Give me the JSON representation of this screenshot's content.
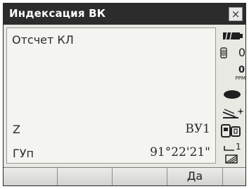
{
  "window": {
    "title": "Индексация ВК",
    "close_label": "×"
  },
  "main": {
    "header": "Отсчет КЛ",
    "rows": [
      {
        "label": "Z",
        "value": "ВУ1"
      },
      {
        "label": "ГУп",
        "value": "91°22'21\""
      }
    ]
  },
  "status": {
    "battery_icon": "battery-icon",
    "prism_constant": "0",
    "ppm_value": "0",
    "ppm_unit": "PPM"
  },
  "softkeys": [
    "",
    "",
    "",
    "Да",
    ""
  ]
}
